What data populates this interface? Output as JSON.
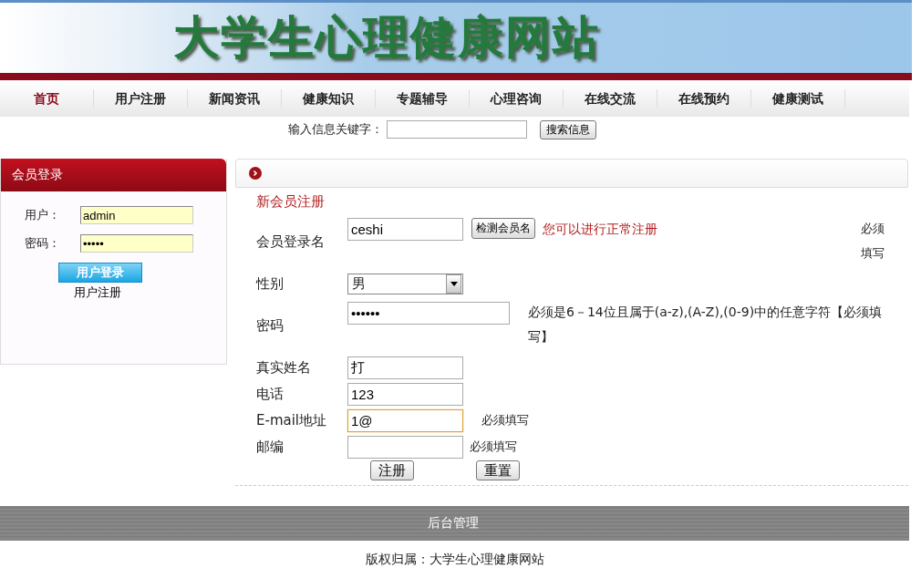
{
  "banner": {
    "title": "大学生心理健康网站"
  },
  "nav": [
    {
      "label": "首页",
      "selected": true
    },
    {
      "label": "用户注册",
      "selected": false
    },
    {
      "label": "新闻资讯",
      "selected": false
    },
    {
      "label": "健康知识",
      "selected": false
    },
    {
      "label": "专题辅导",
      "selected": false
    },
    {
      "label": "心理咨询",
      "selected": false
    },
    {
      "label": "在线交流",
      "selected": false
    },
    {
      "label": "在线预约",
      "selected": false
    },
    {
      "label": "健康测试",
      "selected": false
    }
  ],
  "search": {
    "label": "输入信息关键字：",
    "button": "搜索信息"
  },
  "login": {
    "title": "会员登录",
    "fields": [
      {
        "label": "用户：",
        "value": "admin"
      },
      {
        "label": "密码：",
        "value": "•••••"
      }
    ],
    "button": "用户登录",
    "link": "用户注册"
  },
  "register": {
    "title": "新会员注册",
    "fields": [
      {
        "kind": "text",
        "label": "会员登录名",
        "value": "ceshi",
        "button": "检测会员名",
        "message": "您可以进行正常注册",
        "note": "必须填写",
        "focused": false
      },
      {
        "kind": "select",
        "label": "性别",
        "value": "男",
        "focused": false
      },
      {
        "kind": "password",
        "label": "密码",
        "value": "••••••",
        "note": "必须是6－14位且属于(a-z),(A-Z),(0-9)中的任意字符【必须填写】",
        "focused": false
      },
      {
        "kind": "text",
        "label": "真实姓名",
        "value": "打",
        "focused": false
      },
      {
        "kind": "text",
        "label": "电话",
        "value": "123",
        "focused": false
      },
      {
        "kind": "text",
        "label": "E-mail地址",
        "value": "1@",
        "note": "必须填写",
        "focused": true
      },
      {
        "kind": "text",
        "label": "邮编",
        "note": "必须填写",
        "focused": false
      }
    ],
    "buttons": [
      "注册",
      "重置"
    ]
  },
  "footer": {
    "admin_link": "后台管理",
    "copyright": "版权归属：大学生心理健康网站"
  }
}
